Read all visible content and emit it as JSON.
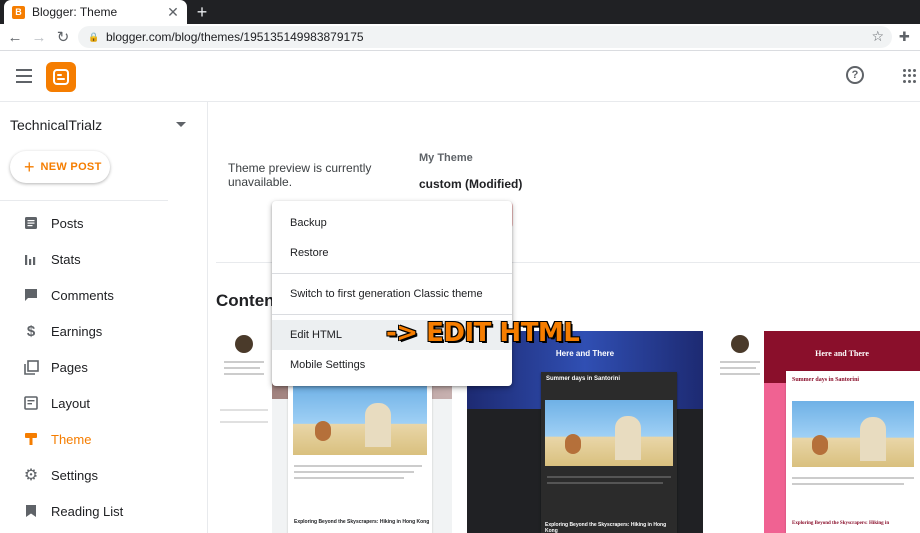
{
  "browser": {
    "tab_title": "Blogger: Theme",
    "tab_close": "✕",
    "new_tab": "+",
    "url": "blogger.com/blog/themes/195135149983879175"
  },
  "sidebar": {
    "blog_name": "TechnicalTrialz",
    "new_post_label": "NEW POST",
    "items": [
      {
        "label": "Posts",
        "icon": "posts-icon"
      },
      {
        "label": "Stats",
        "icon": "stats-icon"
      },
      {
        "label": "Comments",
        "icon": "comments-icon"
      },
      {
        "label": "Earnings",
        "icon": "dollar-icon"
      },
      {
        "label": "Pages",
        "icon": "pages-icon"
      },
      {
        "label": "Layout",
        "icon": "layout-icon"
      },
      {
        "label": "Theme",
        "icon": "theme-icon",
        "active": true
      },
      {
        "label": "Settings",
        "icon": "gear-icon"
      },
      {
        "label": "Reading List",
        "icon": "bookmark-icon"
      }
    ]
  },
  "main": {
    "preview_message": "Theme preview is currently unavailable.",
    "my_theme_label": "My Theme",
    "theme_name": "custom (Modified)",
    "section_heading": "Conten",
    "thumbnails": [
      {
        "blog_title": "",
        "post_title": "Exploring Beyond the Skyscrapers: Hiking in Hong Kong"
      },
      {
        "blog_title": "Here and There",
        "post_title": "Summer days in Santorini",
        "post_title_2": "Exploring Beyond the Skyscrapers: Hiking in Hong Kong"
      },
      {
        "blog_title": "Here and There",
        "post_title": "Summer days in Santorini",
        "post_title_2": "Exploring Beyond the Skyscrapers: Hiking in"
      }
    ]
  },
  "menu": {
    "items": [
      "Backup",
      "Restore",
      "Switch to first generation Classic theme",
      "Edit HTML",
      "Mobile Settings"
    ]
  },
  "annotation": "-> EDIT HTML",
  "colors": {
    "accent": "#f57d00",
    "hover": "#eceff1"
  }
}
